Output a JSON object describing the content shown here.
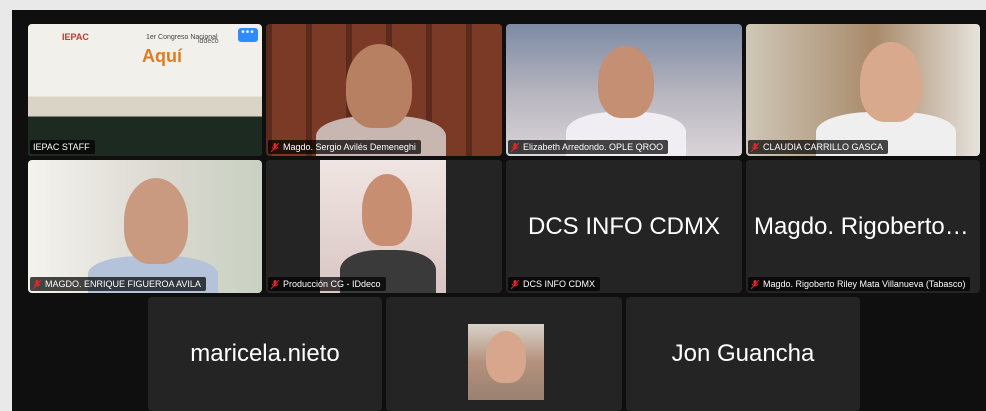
{
  "participants": [
    {
      "id": "iepac",
      "label": "IEPAC STAFF",
      "active": true,
      "video": true,
      "more_icon": "more-horizontal-icon",
      "signage": {
        "org": "IEPAC",
        "title": "Aquí",
        "subtitle": "1er Congreso Nacional",
        "org2": "iddeco"
      }
    },
    {
      "id": "sergio",
      "label": "Magdo. Sergio Avilés Demeneghi",
      "video": true
    },
    {
      "id": "elizabeth",
      "label": "Elizabeth Arredondo. OPLE QROO",
      "video": true
    },
    {
      "id": "claudia",
      "label": "CLAUDIA CARRILLO GASCA",
      "video": true
    },
    {
      "id": "enrique",
      "label": "MAGDO. ENRIQUE FIGUEROA AVILA",
      "video": true
    },
    {
      "id": "produccion",
      "label": "Producción CG - IDdeco",
      "video": true
    },
    {
      "id": "dcs",
      "label": "DCS INFO CDMX",
      "display_name": "DCS INFO CDMX",
      "video": false
    },
    {
      "id": "rigoberto",
      "label": "Magdo. Rigoberto Riley Mata Villanueva (Tabasco)",
      "display_name": "Magdo. Rigoberto Riley Mata Villanueva",
      "video": false
    },
    {
      "id": "maricela",
      "display_name": "maricela.nieto",
      "video": false
    },
    {
      "id": "thumb",
      "video": true,
      "thumbnail": true
    },
    {
      "id": "jon",
      "display_name": "Jon Guancha",
      "video": false
    }
  ],
  "colors": {
    "active_outline": "#3cc93c",
    "mic_muted": "#e02828",
    "tile_bg": "#242424",
    "more_button": "#2d8cff"
  }
}
